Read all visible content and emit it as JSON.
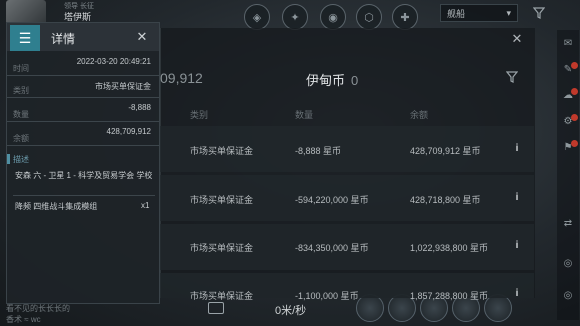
{
  "hud": {
    "pilot_corp": "领导 长征",
    "pilot_name": "塔伊斯",
    "dropdown_label": "舰船",
    "speed": "0米/秒",
    "bottom_text_1": "看不见的长长长的",
    "bottom_text_2": "香术 ≈ wc"
  },
  "main": {
    "balance_partial": "09,912",
    "currency_title": "伊甸币",
    "currency_amount": "0",
    "columns": [
      "类别",
      "数量",
      "余额"
    ],
    "rows": [
      {
        "category": "市场买单保证金",
        "amount": "-8,888",
        "unit": "星币",
        "balance": "428,709,912 星币"
      },
      {
        "category": "市场买单保证金",
        "amount": "-594,220,000",
        "unit": "星币",
        "balance": "428,718,800 星币"
      },
      {
        "category": "市场买单保证金",
        "amount": "-834,350,000",
        "unit": "星币",
        "balance": "1,022,938,800 星币"
      },
      {
        "category": "市场买单保证金",
        "amount": "-1,100,000",
        "unit": "星币",
        "balance": "1,857,288,800 星币"
      }
    ]
  },
  "detail": {
    "title": "详情",
    "fields": [
      {
        "label": "时间",
        "value": "2022-03-20 20:49:21"
      },
      {
        "label": "类别",
        "value": "市场买单保证金"
      },
      {
        "label": "数量",
        "value": "-8,888"
      },
      {
        "label": "余额",
        "value": "428,709,912"
      }
    ],
    "desc_label": "描述",
    "description": "安森 六 - 卫星 1 - 科学及贸易学会 学校",
    "item_name": "降频 四维战斗集成模组",
    "item_qty": "x1"
  },
  "colors": {
    "accent": "#2f7f8f",
    "negative": "#c45050"
  },
  "icons": [
    "menu-icon",
    "close-icon",
    "filter-icon",
    "info-icon",
    "camera-icon",
    "chevron-down-icon"
  ]
}
